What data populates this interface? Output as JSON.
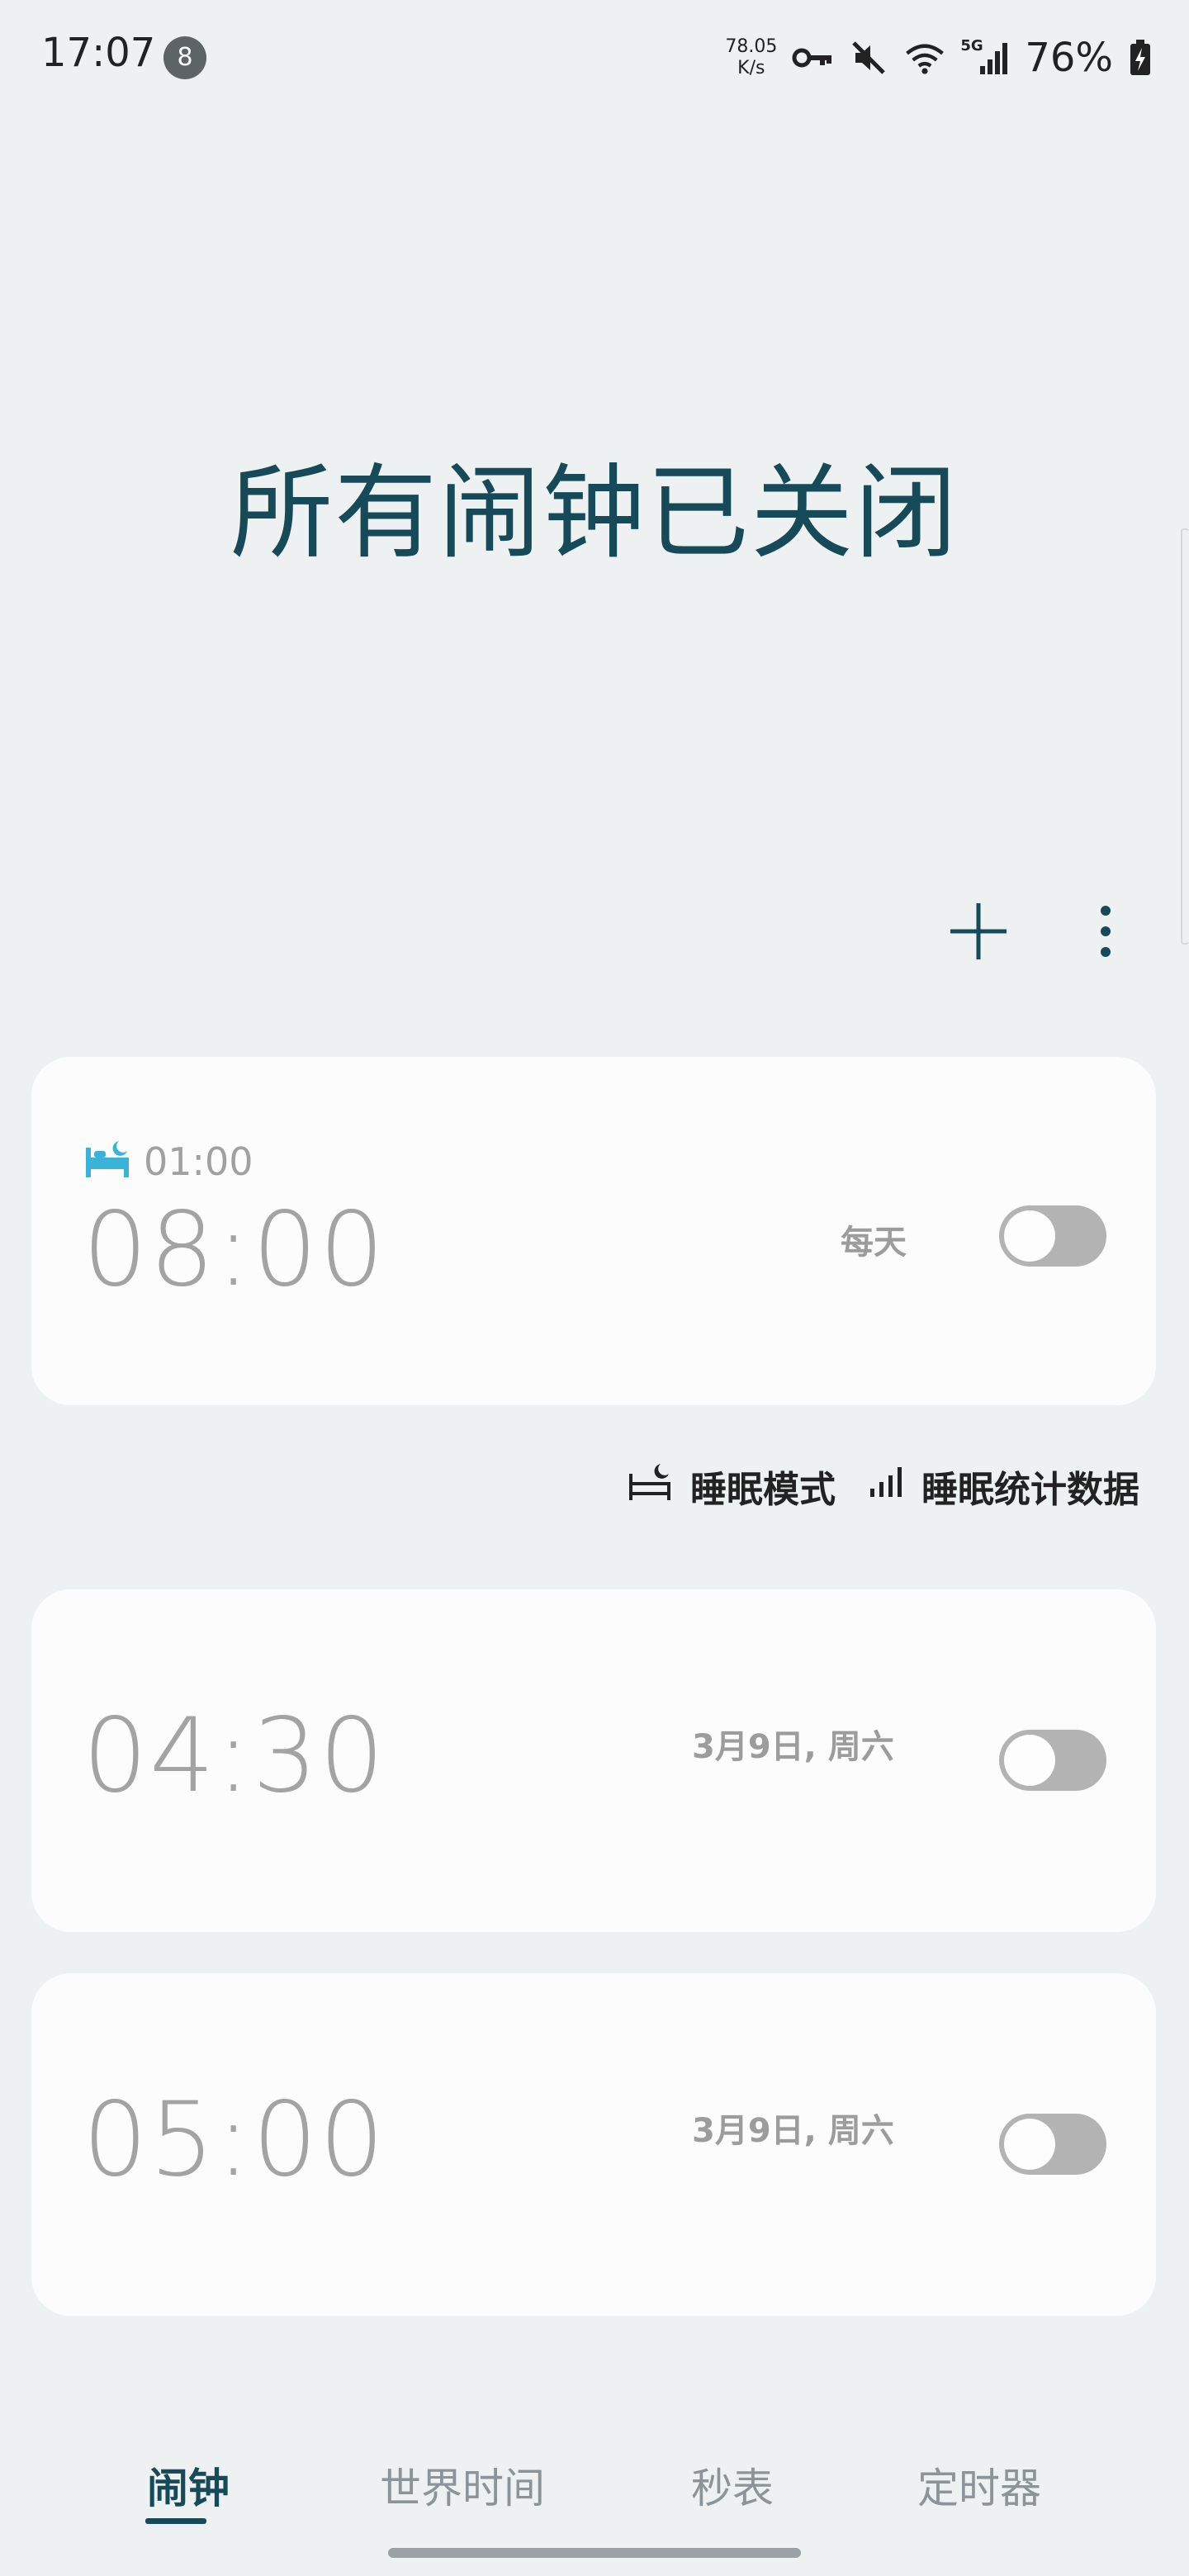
{
  "status_bar": {
    "time": "17:07",
    "notification_count": "8",
    "net_speed_value": "78.05",
    "net_speed_unit": "K/s",
    "network_type": "5G",
    "battery": "76%",
    "icons": [
      "vpn-key-icon",
      "mute-icon",
      "wifi-icon",
      "signal-icon",
      "battery-charging-icon"
    ]
  },
  "header": {
    "title": "所有闹钟已关闭"
  },
  "actions": {
    "add_icon": "plus-icon",
    "more_icon": "more-vertical-icon"
  },
  "alarms": [
    {
      "bedtime": "01:00",
      "time": "08:00",
      "days": "每天",
      "enabled": false,
      "icon": "bed-icon"
    },
    {
      "time": "04:30",
      "days": "3月9日, 周六",
      "enabled": false
    },
    {
      "time": "05:00",
      "days": "3月9日, 周六",
      "enabled": false
    }
  ],
  "sleep_links": {
    "sleep_mode": "睡眠模式",
    "sleep_stats": "睡眠统计数据"
  },
  "bottom_nav": {
    "tabs": [
      {
        "label": "闹钟",
        "active": true
      },
      {
        "label": "世界时间",
        "active": false
      },
      {
        "label": "秒表",
        "active": false
      },
      {
        "label": "定时器",
        "active": false
      }
    ]
  },
  "colors": {
    "accent": "#174a59",
    "bed_icon": "#3bb3d9",
    "background": "#eef1f2",
    "card": "#fcfcfc",
    "toggle_off": "#b3b3b3"
  }
}
